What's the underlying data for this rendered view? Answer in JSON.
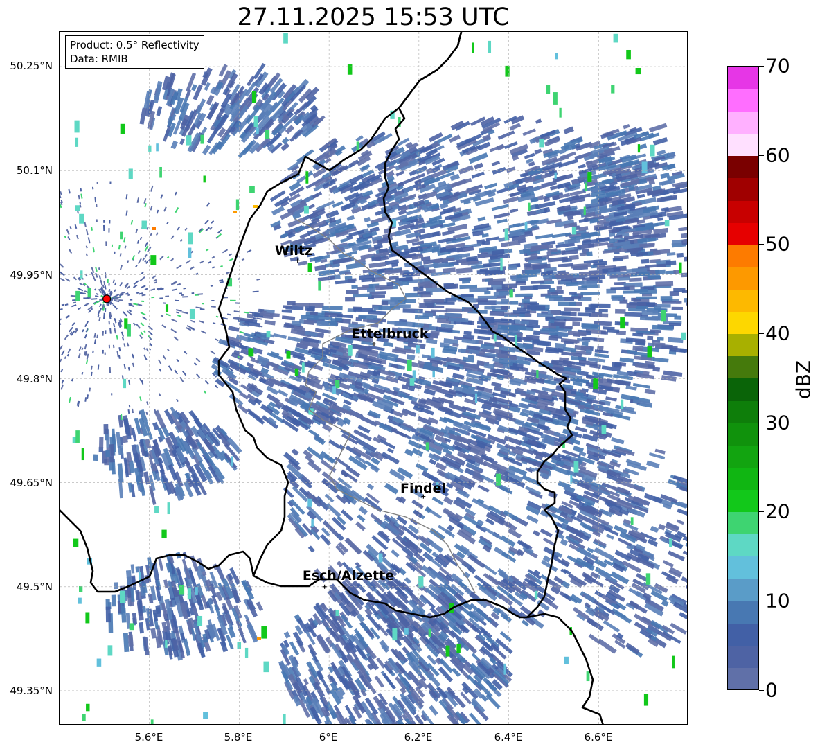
{
  "title": "27.11.2025 15:53 UTC",
  "info": {
    "product": "Product: 0.5° Reflectivity",
    "data": "Data: RMIB"
  },
  "axes": {
    "lat_ticks": [
      "50.25°N",
      "50.1°N",
      "49.95°N",
      "49.8°N",
      "49.65°N",
      "49.5°N",
      "49.35°N"
    ],
    "lon_ticks": [
      "5.6°E",
      "5.8°E",
      "6°E",
      "6.2°E",
      "6.4°E",
      "6.6°E"
    ]
  },
  "cities": [
    {
      "name": "Wiltz",
      "lon": 5.93,
      "lat": 49.97
    },
    {
      "name": "Ettelbruck",
      "lon": 6.1,
      "lat": 49.85
    },
    {
      "name": "Findel",
      "lon": 6.21,
      "lat": 49.63
    },
    {
      "name": "Esch/Alzette",
      "lon": 5.99,
      "lat": 49.5
    }
  ],
  "radar_site": {
    "lon": 5.505,
    "lat": 49.915
  },
  "colorbar": {
    "unit": "dBZ",
    "min": 0,
    "max": 70,
    "tick_labels": [
      "0",
      "10",
      "20",
      "30",
      "40",
      "50",
      "60",
      "70"
    ],
    "colors": [
      "#6070a8",
      "#4e63a4",
      "#4260a6",
      "#4878b2",
      "#5a9cc8",
      "#62c0dc",
      "#5ed8c4",
      "#3ed471",
      "#12c81a",
      "#10b612",
      "#12a410",
      "#10920c",
      "#0e7e0a",
      "#0a6408",
      "#457a0c",
      "#a8b000",
      "#fdd700",
      "#fdb900",
      "#fd9900",
      "#fd7b00",
      "#e60000",
      "#c80000",
      "#a00000",
      "#7a0000",
      "#ffe0ff",
      "#ffb0ff",
      "#ff6eff",
      "#e636e6"
    ]
  },
  "colors": {
    "border": "#000000",
    "province_border": "#808080",
    "grid": "#aaaaaa",
    "radar_site": "#ff0000"
  }
}
